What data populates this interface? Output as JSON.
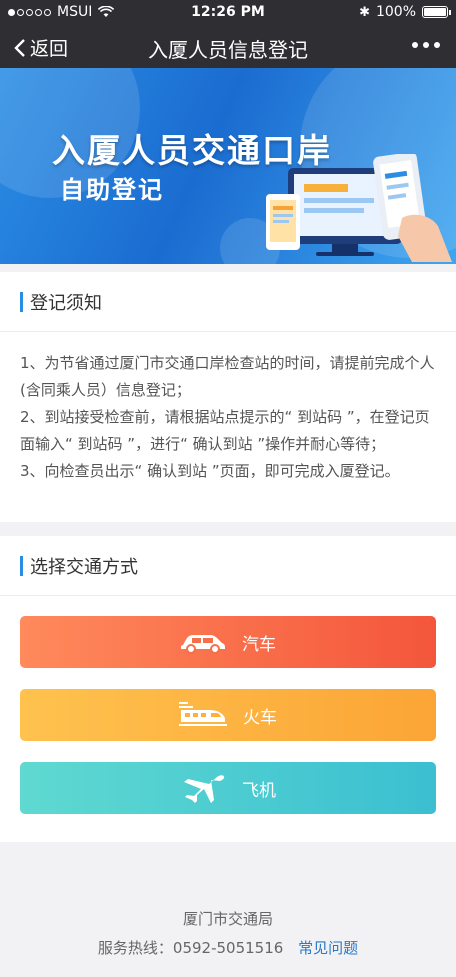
{
  "status_bar": {
    "carrier": "MSUI",
    "time": "12:26 PM",
    "battery": "100%"
  },
  "nav": {
    "back_label": "返回",
    "title": "入厦人员信息登记"
  },
  "banner": {
    "line1": "入厦人员交通口岸",
    "line2": "自助登记"
  },
  "notice": {
    "title": "登记须知",
    "items": [
      "1、为节省通过厦门市交通口岸检查站的时间，请提前完成个人(含同乘人员）信息登记；",
      "2、到站接受检查前，请根据站点提示的“ 到站码 ”，在登记页面输入“ 到站码 ”，进行“ 确认到站 ”操作并耐心等待；",
      "3、向检查员出示“ 确认到站 ”页面，即可完成入厦登记。"
    ]
  },
  "transport": {
    "title": "选择交通方式",
    "options": [
      {
        "label": "汽车",
        "icon": "car-icon"
      },
      {
        "label": "火车",
        "icon": "train-icon"
      },
      {
        "label": "飞机",
        "icon": "plane-icon"
      }
    ]
  },
  "footer": {
    "org": "厦门市交通局",
    "hotline_label": "服务热线：",
    "hotline": "0592-5051516",
    "faq": "常见问题"
  },
  "colors": {
    "accent": "#2a8de4",
    "car": "#f4563b",
    "train": "#fba536",
    "plane": "#3bbfd1"
  }
}
